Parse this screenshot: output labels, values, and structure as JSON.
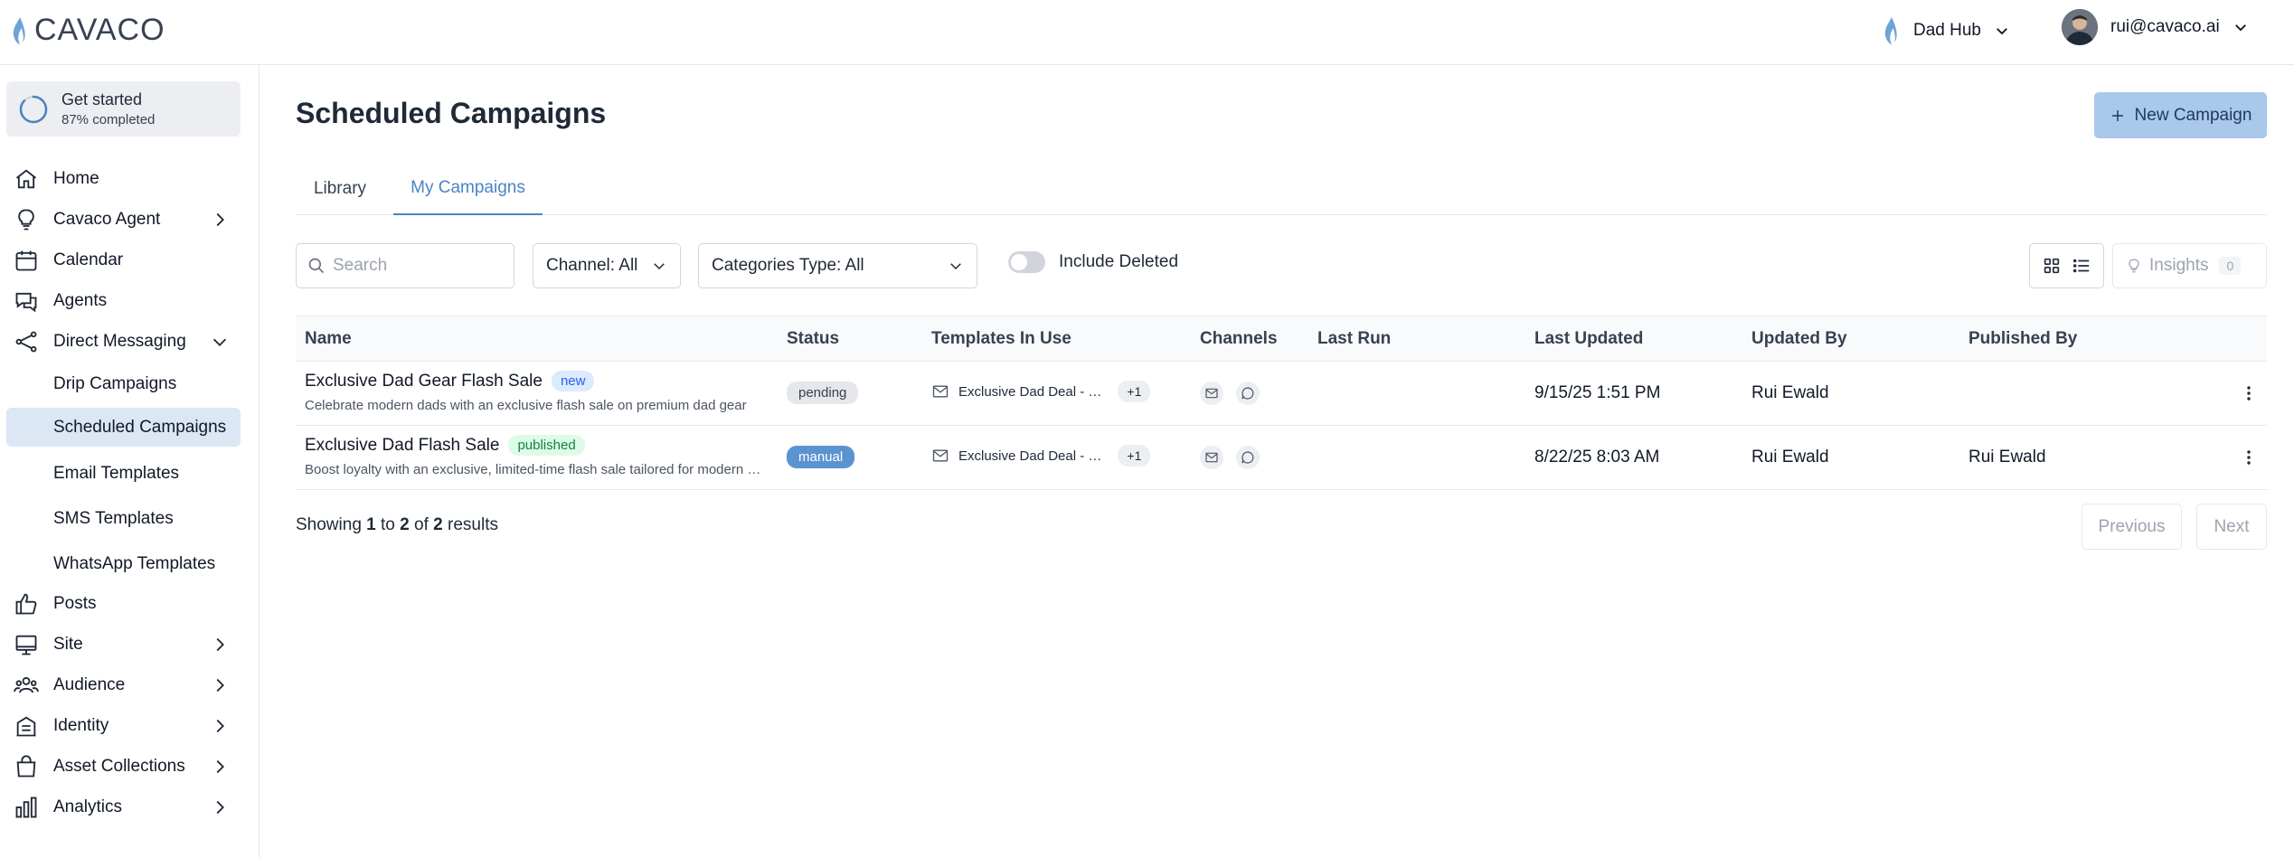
{
  "brand": {
    "name": "CAVACO",
    "accent": "#4a84c4"
  },
  "header": {
    "hub": "Dad Hub",
    "user_email": "rui@cavaco.ai"
  },
  "sidebar": {
    "get_started": {
      "title": "Get started",
      "progress_text": "87% completed",
      "progress": 0.87
    },
    "items": [
      {
        "label": "Home",
        "icon": "home-icon"
      },
      {
        "label": "Cavaco Agent",
        "icon": "lightbulb-icon"
      },
      {
        "label": "Calendar",
        "icon": "calendar-icon"
      },
      {
        "label": "Agents",
        "icon": "chat-icon"
      },
      {
        "label": "Direct Messaging",
        "icon": "share-icon"
      },
      {
        "label": "Posts",
        "icon": "thumbs-up-icon"
      },
      {
        "label": "Site",
        "icon": "monitor-icon"
      },
      {
        "label": "Audience",
        "icon": "users-icon"
      },
      {
        "label": "Identity",
        "icon": "building-icon"
      },
      {
        "label": "Asset Collections",
        "icon": "bag-icon"
      },
      {
        "label": "Analytics",
        "icon": "bar-chart-icon"
      }
    ],
    "sub_items": [
      {
        "label": "Drip Campaigns"
      },
      {
        "label": "Scheduled Campaigns"
      },
      {
        "label": "Email Templates"
      },
      {
        "label": "SMS Templates"
      },
      {
        "label": "WhatsApp Templates"
      }
    ]
  },
  "main": {
    "title": "Scheduled Campaigns",
    "new_button": "New Campaign",
    "tabs": [
      {
        "label": "Library"
      },
      {
        "label": "My Campaigns"
      }
    ],
    "filters": {
      "search_placeholder": "Search",
      "channel": "Channel: All",
      "categories": "Categories Type: All",
      "include_deleted": "Include Deleted",
      "insights": "Insights",
      "insights_count": "0"
    },
    "columns": [
      "Name",
      "Status",
      "Templates In Use",
      "Channels",
      "Last Run",
      "Last Updated",
      "Updated By",
      "Published By"
    ],
    "rows": [
      {
        "name": "Exclusive Dad Gear Flash Sale",
        "tag": "new",
        "description": "Celebrate modern dads with an exclusive flash sale on premium dad gear",
        "status": "pending",
        "template": "Exclusive Dad Deal - …",
        "template_extra": "+1",
        "last_run": "",
        "last_updated": "9/15/25 1:51 PM",
        "updated_by": "Rui Ewald",
        "published_by": ""
      },
      {
        "name": "Exclusive Dad Flash Sale",
        "tag": "published",
        "description": "Boost loyalty with an exclusive, limited-time flash sale tailored for modern dads",
        "status": "manual",
        "template": "Exclusive Dad Deal - …",
        "template_extra": "+1",
        "last_run": "",
        "last_updated": "8/22/25 8:03 AM",
        "updated_by": "Rui Ewald",
        "published_by": "Rui Ewald"
      }
    ],
    "pagination": {
      "showing": "Showing",
      "from": "1",
      "to_word": "to",
      "to": "2",
      "of_word": "of",
      "total": "2",
      "results_word": "results",
      "previous": "Previous",
      "next": "Next"
    }
  }
}
